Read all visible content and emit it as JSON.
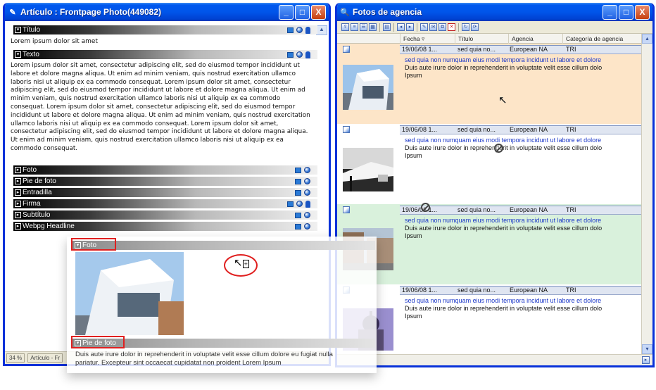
{
  "left_window": {
    "title": "Artículo : Frontpage Photo(449082)",
    "buttons": {
      "minimize": "_",
      "maximize": "□",
      "close": "X"
    },
    "sections": [
      {
        "label": "Título",
        "value": "Lorem ipsum dolor sit amet"
      },
      {
        "label": "Texto",
        "value": "Lorem ipsum dolor sit amet, consectetur adipiscing elit, sed do eiusmod tempor incididunt ut labore et dolore magna aliqua. Ut enim ad minim veniam, quis nostrud exercitation ullamco laboris nisi ut aliquip ex ea commodo consequat. Lorem ipsum dolor sit amet, consectetur adipiscing elit, sed do eiusmod tempor incididunt ut labore et dolore magna aliqua. Ut enim ad minim veniam, quis nostrud exercitation ullamco laboris nisi ut aliquip ex ea commodo consequat. Lorem ipsum dolor sit amet, consectetur adipiscing elit, sed do eiusmod tempor incididunt ut labore et dolore magna aliqua. Ut enim ad minim veniam, quis nostrud exercitation ullamco laboris nisi ut aliquip ex ea commodo consequat. Lorem ipsum dolor sit amet, consectetur adipiscing elit, sed do eiusmod tempor incididunt ut labore et dolore magna aliqua. Ut enim ad minim veniam, quis nostrud exercitation ullamco laboris nisi ut aliquip ex ea commodo consequat."
      },
      {
        "label": "Foto"
      },
      {
        "label": "Pie de foto"
      },
      {
        "label": "Entradilla"
      },
      {
        "label": "Firma"
      },
      {
        "label": "Subtítulo"
      },
      {
        "label": "Webpg Headline"
      }
    ],
    "status": {
      "zoom": "34 %",
      "mode": "Artículo - Fr"
    }
  },
  "drag_panel": {
    "foto_label": "Foto",
    "pie_label": "Pie de foto",
    "caption": "Duis aute irure dolor in reprehenderit in voluptate velit esse cillum dolore eu fugiat nulla pariatur. Excepteur sint occaecat cupidatat non proident Lorem Ipsum"
  },
  "right_window": {
    "title": "Fotos de agencia",
    "columns": [
      "Fecha",
      "Título",
      "Agencia",
      "Categoría de agencia"
    ],
    "items": [
      {
        "date": "19/06/08 1...",
        "title": "sed quia no...",
        "agency": "European NA",
        "category": "TRI",
        "headline": "sed quia non numquam eius modi tempora incidunt ut labore et dolore",
        "desc_line1": "Duis aute irure dolor in reprehenderit in voluptate velit esse cillum dolo",
        "desc_line2": "Ipsum",
        "bg": "#fde5c8"
      },
      {
        "date": "19/06/08 1...",
        "title": "sed quia no...",
        "agency": "European NA",
        "category": "TRI",
        "headline": "sed quia non numquam eius modi tempora incidunt ut labore et dolore",
        "desc_line1": "Duis aute irure dolor in reprehenderit in voluptate velit esse cillum dolo",
        "desc_line2": "Ipsum",
        "bg": "#ffffff"
      },
      {
        "date": "19/06/08 1...",
        "title": "sed quia no...",
        "agency": "European NA",
        "category": "TRI",
        "headline": "sed quia non numquam eius modi tempora incidunt ut labore et dolore",
        "desc_line1": "Duis aute irure dolor in reprehenderit in voluptate velit esse cillum dolo",
        "desc_line2": "Ipsum",
        "bg": "#d9f1dc"
      },
      {
        "date": "19/06/08 1...",
        "title": "sed quia no...",
        "agency": "European NA",
        "category": "TRI",
        "headline": "sed quia non numquam eius modi tempora incidunt ut labore et dolore",
        "desc_line1": "Duis aute irure dolor in reprehenderit in voluptate velit esse cillum dolo",
        "desc_line2": "Ipsum",
        "bg": "#ffffff"
      }
    ]
  },
  "colors": {
    "titlebar": "#0055ea",
    "highlight": "#e02020",
    "link": "#1c38c8"
  }
}
